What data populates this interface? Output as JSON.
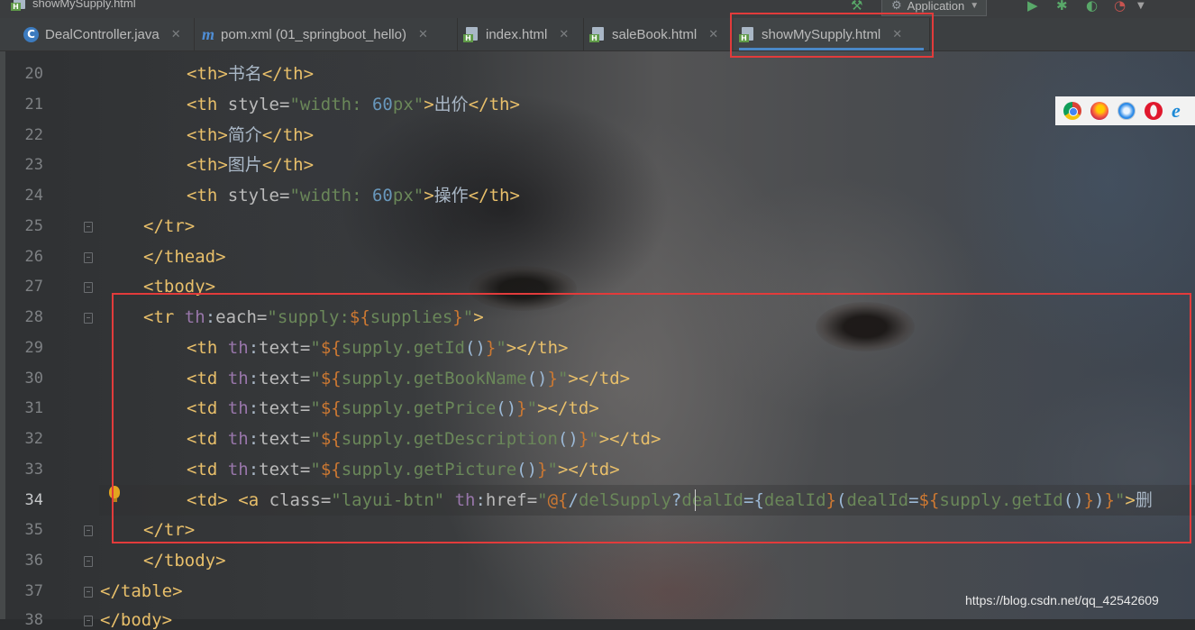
{
  "window": {
    "file_title": "showMySupply.html",
    "run_config": "Application"
  },
  "tabs": [
    {
      "label": "DealController.java",
      "icon": "java-class-icon"
    },
    {
      "label": "pom.xml (01_springboot_hello)",
      "icon": "maven-icon"
    },
    {
      "label": "index.html",
      "icon": "html-file-icon"
    },
    {
      "label": "saleBook.html",
      "icon": "html-file-icon"
    },
    {
      "label": "showMySupply.html",
      "icon": "html-file-icon",
      "active": true
    }
  ],
  "editor": {
    "current_line": 34,
    "lines": [
      {
        "n": "20",
        "code": "<th>书名</th>"
      },
      {
        "n": "21",
        "code": "<th style=\"width: 60px\">出价</th>"
      },
      {
        "n": "22",
        "code": "<th>简介</th>"
      },
      {
        "n": "23",
        "code": "<th>图片</th>"
      },
      {
        "n": "24",
        "code": "<th style=\"width: 60px\">操作</th>"
      },
      {
        "n": "25",
        "code": "</tr>"
      },
      {
        "n": "26",
        "code": "</thead>"
      },
      {
        "n": "27",
        "code": "<tbody>"
      },
      {
        "n": "28",
        "code": "<tr th:each=\"supply:${supplies}\">"
      },
      {
        "n": "29",
        "code": "<th th:text=\"${supply.getId()}\"></th>"
      },
      {
        "n": "30",
        "code": "<td th:text=\"${supply.getBookName()}\"></td>"
      },
      {
        "n": "31",
        "code": "<td th:text=\"${supply.getPrice()}\"></td>"
      },
      {
        "n": "32",
        "code": "<td th:text=\"${supply.getDescription()}\"></td>"
      },
      {
        "n": "33",
        "code": "<td th:text=\"${supply.getPicture()}\"></td>"
      },
      {
        "n": "34",
        "code": "<td> <a class=\"layui-btn\" th:href=\"@{/delSupply?dealId={dealId}(dealId=${supply.getId()})}\">删"
      },
      {
        "n": "35",
        "code": "</tr>"
      },
      {
        "n": "36",
        "code": "</tbody>"
      },
      {
        "n": "37",
        "code": "</table>"
      },
      {
        "n": "38",
        "code": "</body>"
      }
    ]
  },
  "browser_icons": [
    "chrome-icon",
    "firefox-icon",
    "safari-icon",
    "opera-icon",
    "ie-icon"
  ],
  "watermark": "https://blog.csdn.net/qq_42542609",
  "colors": {
    "tag": "#e8bf6a",
    "attr": "#bababa",
    "namespace": "#9876aa",
    "string": "#6a8759",
    "number": "#6897bb",
    "highlight_box": "#e23b3b",
    "active_tab_underline": "#4a88c7"
  }
}
